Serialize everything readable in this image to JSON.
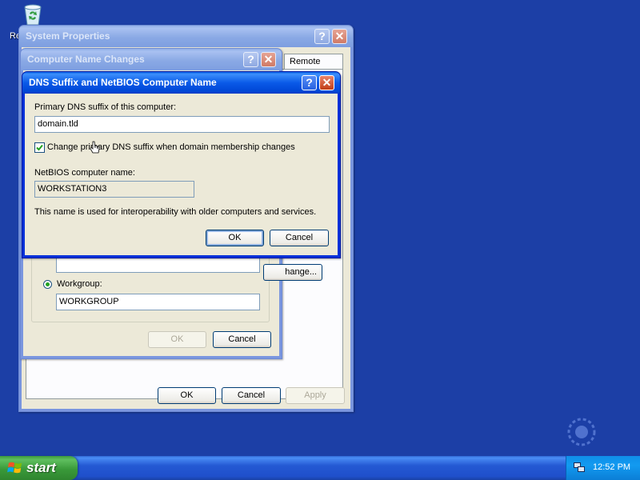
{
  "desktop": {
    "recycle_bin_label": "Re"
  },
  "system_properties": {
    "title": "System Properties",
    "help_label": "?",
    "close_label": "✕",
    "tab_remote": "Remote",
    "ok_label": "OK",
    "cancel_label": "Cancel",
    "apply_label": "Apply"
  },
  "computer_name_changes": {
    "title": "Computer Name Changes",
    "help_label": "?",
    "close_label": "✕",
    "domain_value": "",
    "change_button_label": "hange...",
    "workgroup_label": "Workgroup:",
    "workgroup_value": "WORKGROUP",
    "ok_label": "OK",
    "cancel_label": "Cancel"
  },
  "dns_dialog": {
    "title": "DNS Suffix and NetBIOS Computer Name",
    "help_label": "?",
    "close_label": "✕",
    "primary_dns_label": "Primary DNS suffix of this computer:",
    "primary_dns_value": "domain.tld",
    "change_checkbox_label": "Change primary DNS suffix when domain membership changes",
    "change_checkbox_checked": true,
    "netbios_label": "NetBIOS computer name:",
    "netbios_value": "WORKSTATION3",
    "info_text": "This name is used for interoperability with older computers and services.",
    "ok_label": "OK",
    "cancel_label": "Cancel"
  },
  "taskbar": {
    "start_label": "start",
    "clock": "12:52 PM"
  },
  "icons": [
    "recycle-bin-icon",
    "network-icon",
    "windows-flag-icon",
    "mouse-cursor-icon",
    "watermark-logo-icon"
  ],
  "colors": {
    "desktop": "#1c3fa6",
    "title_active": "#0a5ae8",
    "dialog_face": "#ece9d8",
    "start_green": "#3a9a3a"
  }
}
